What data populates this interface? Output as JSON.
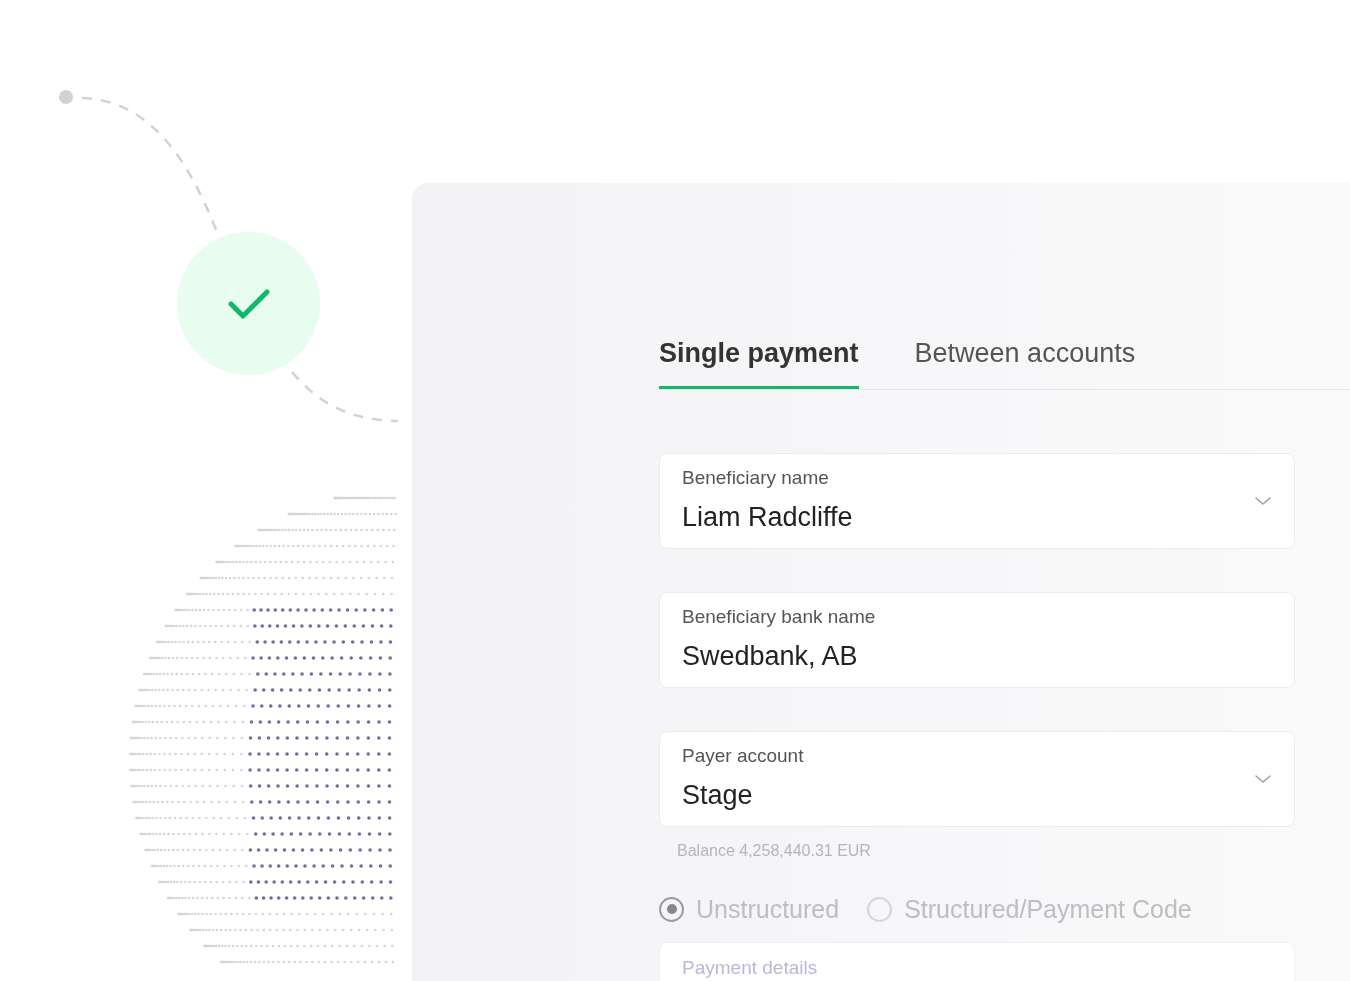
{
  "tabs": [
    {
      "label": "Single payment",
      "selected": true
    },
    {
      "label": "Between accounts",
      "selected": false
    }
  ],
  "fields": [
    {
      "kind": "dropdown",
      "label": "Beneficiary name",
      "value": "Liam Radcliffe"
    },
    {
      "kind": "text",
      "label": "Beneficiary bank name",
      "value": "Swedbank, AB"
    },
    {
      "kind": "dropdown",
      "label": "Payer account",
      "value": "Stage",
      "note": "Balance 4,258,440.31 EUR"
    }
  ],
  "reference_types": [
    {
      "label": "Unstructured",
      "selected": true
    },
    {
      "label": "Structured/Payment Code",
      "selected": false
    }
  ],
  "payment_details": {
    "placeholder": "Payment details"
  }
}
